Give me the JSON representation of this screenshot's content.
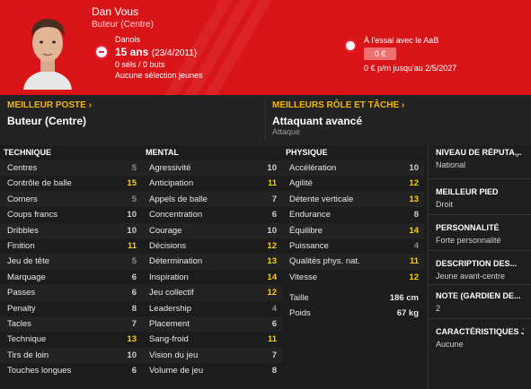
{
  "header": {
    "name": "Dan Vous",
    "role": "Buteur (Centre)",
    "nationality": "Danois",
    "age": "15 ans",
    "birthdate": "(23/4/2011)",
    "caps": "0 séls / 0 buts",
    "youth": "Aucune sélection jeunes",
    "contract_label": "À l'essai avec le AaB",
    "value": "0 €",
    "wage": "0 € p/m jusqu'au 2/5/2027"
  },
  "positions": {
    "best_position_title": "MEILLEUR POSTE",
    "best_position_value": "Buteur (Centre)",
    "best_role_title": "MEILLEURS RÔLE ET TÂCHE",
    "best_role_value": "Attaquant avancé",
    "best_role_duty": "Attaque"
  },
  "technique": {
    "title": "TECHNIQUE",
    "rows": [
      {
        "label": "Centres",
        "value": "5"
      },
      {
        "label": "Contrôle de balle",
        "value": "15"
      },
      {
        "label": "Corners",
        "value": "5"
      },
      {
        "label": "Coups francs",
        "value": "10"
      },
      {
        "label": "Dribbles",
        "value": "10"
      },
      {
        "label": "Finition",
        "value": "11"
      },
      {
        "label": "Jeu de tête",
        "value": "5"
      },
      {
        "label": "Marquage",
        "value": "6"
      },
      {
        "label": "Passes",
        "value": "6"
      },
      {
        "label": "Penalty",
        "value": "8"
      },
      {
        "label": "Tacles",
        "value": "7"
      },
      {
        "label": "Technique",
        "value": "13"
      },
      {
        "label": "Tirs de loin",
        "value": "10"
      },
      {
        "label": "Touches longues",
        "value": "6"
      }
    ]
  },
  "mental": {
    "title": "MENTAL",
    "rows": [
      {
        "label": "Agressivité",
        "value": "10"
      },
      {
        "label": "Anticipation",
        "value": "11"
      },
      {
        "label": "Appels de balle",
        "value": "7"
      },
      {
        "label": "Concentration",
        "value": "6"
      },
      {
        "label": "Courage",
        "value": "10"
      },
      {
        "label": "Décisions",
        "value": "12"
      },
      {
        "label": "Détermination",
        "value": "13"
      },
      {
        "label": "Inspiration",
        "value": "14"
      },
      {
        "label": "Jeu collectif",
        "value": "12"
      },
      {
        "label": "Leadership",
        "value": "4"
      },
      {
        "label": "Placement",
        "value": "6"
      },
      {
        "label": "Sang-froid",
        "value": "11"
      },
      {
        "label": "Vision du jeu",
        "value": "7"
      },
      {
        "label": "Volume de jeu",
        "value": "8"
      }
    ]
  },
  "physique": {
    "title": "PHYSIQUE",
    "rows": [
      {
        "label": "Accélération",
        "value": "10"
      },
      {
        "label": "Agilité",
        "value": "12"
      },
      {
        "label": "Détente verticale",
        "value": "13"
      },
      {
        "label": "Endurance",
        "value": "8"
      },
      {
        "label": "Équilibre",
        "value": "14"
      },
      {
        "label": "Puissance",
        "value": "4"
      },
      {
        "label": "Qualités phys. nat.",
        "value": "11"
      },
      {
        "label": "Vitesse",
        "value": "12"
      }
    ],
    "height_label": "Taille",
    "height_value": "186 cm",
    "weight_label": "Poids",
    "weight_value": "67 kg"
  },
  "right_panel": {
    "reputation_title": "NIVEAU DE RÉPUTA...",
    "reputation_value": "National",
    "foot_title": "MEILLEUR PIED",
    "foot_value": "Droit",
    "personality_title": "PERSONNALITÉ",
    "personality_value": "Forte personnalité",
    "description_title": "DESCRIPTION DES...",
    "description_value": "Jeune avant-centre",
    "goalkeeper_title": "NOTE (GARDIEN DE...",
    "goalkeeper_value": "2",
    "characteristics_title": "CARACTÉRISTIQUES J",
    "characteristics_value": "Aucune"
  },
  "colors": {
    "header_red": "#d9151a",
    "highlight_yellow": "#f2d20a",
    "title_gold": "#f2b705"
  }
}
